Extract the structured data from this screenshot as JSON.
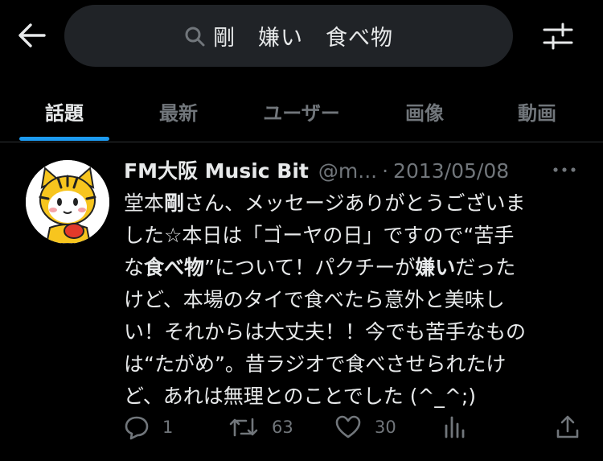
{
  "header": {
    "search_query": "剛　嫌い　食べ物",
    "back_icon": "arrow-left-icon",
    "filter_icon": "sliders-icon",
    "search_icon": "search-icon"
  },
  "tabs": [
    {
      "label": "話題",
      "active": true
    },
    {
      "label": "最新",
      "active": false
    },
    {
      "label": "ユーザー",
      "active": false
    },
    {
      "label": "画像",
      "active": false
    },
    {
      "label": "動画",
      "active": false
    }
  ],
  "tweet": {
    "author_name": "FM大阪 Music Bit",
    "handle": "@m...",
    "separator": "·",
    "date": "2013/05/08",
    "more_icon": "more-dots-icon",
    "lines": [
      [
        "堂本",
        "剛",
        "さん、メッセージありがとうございま"
      ],
      [
        "した☆本日は「ゴーヤの日」ですので“苦手"
      ],
      [
        "な",
        "食べ物",
        "”について！パクチーが",
        "嫌い",
        "だった"
      ],
      [
        "けど、本場のタイで食べたら意外と美味し"
      ],
      [
        "い！それからは大丈夫！！今でも苦手なもの"
      ],
      [
        "は“たがめ”。昔ラジオで食べさせられたけ"
      ],
      [
        "ど、あれは無理とのことでした (^_^;)"
      ]
    ],
    "actions": {
      "reply_count": "1",
      "retweet_count": "63",
      "like_count": "30"
    }
  },
  "colors": {
    "background": "#000000",
    "accent": "#1d9bf0",
    "muted": "#71767b",
    "text": "#e7e9ea",
    "search_bg": "#202327"
  }
}
